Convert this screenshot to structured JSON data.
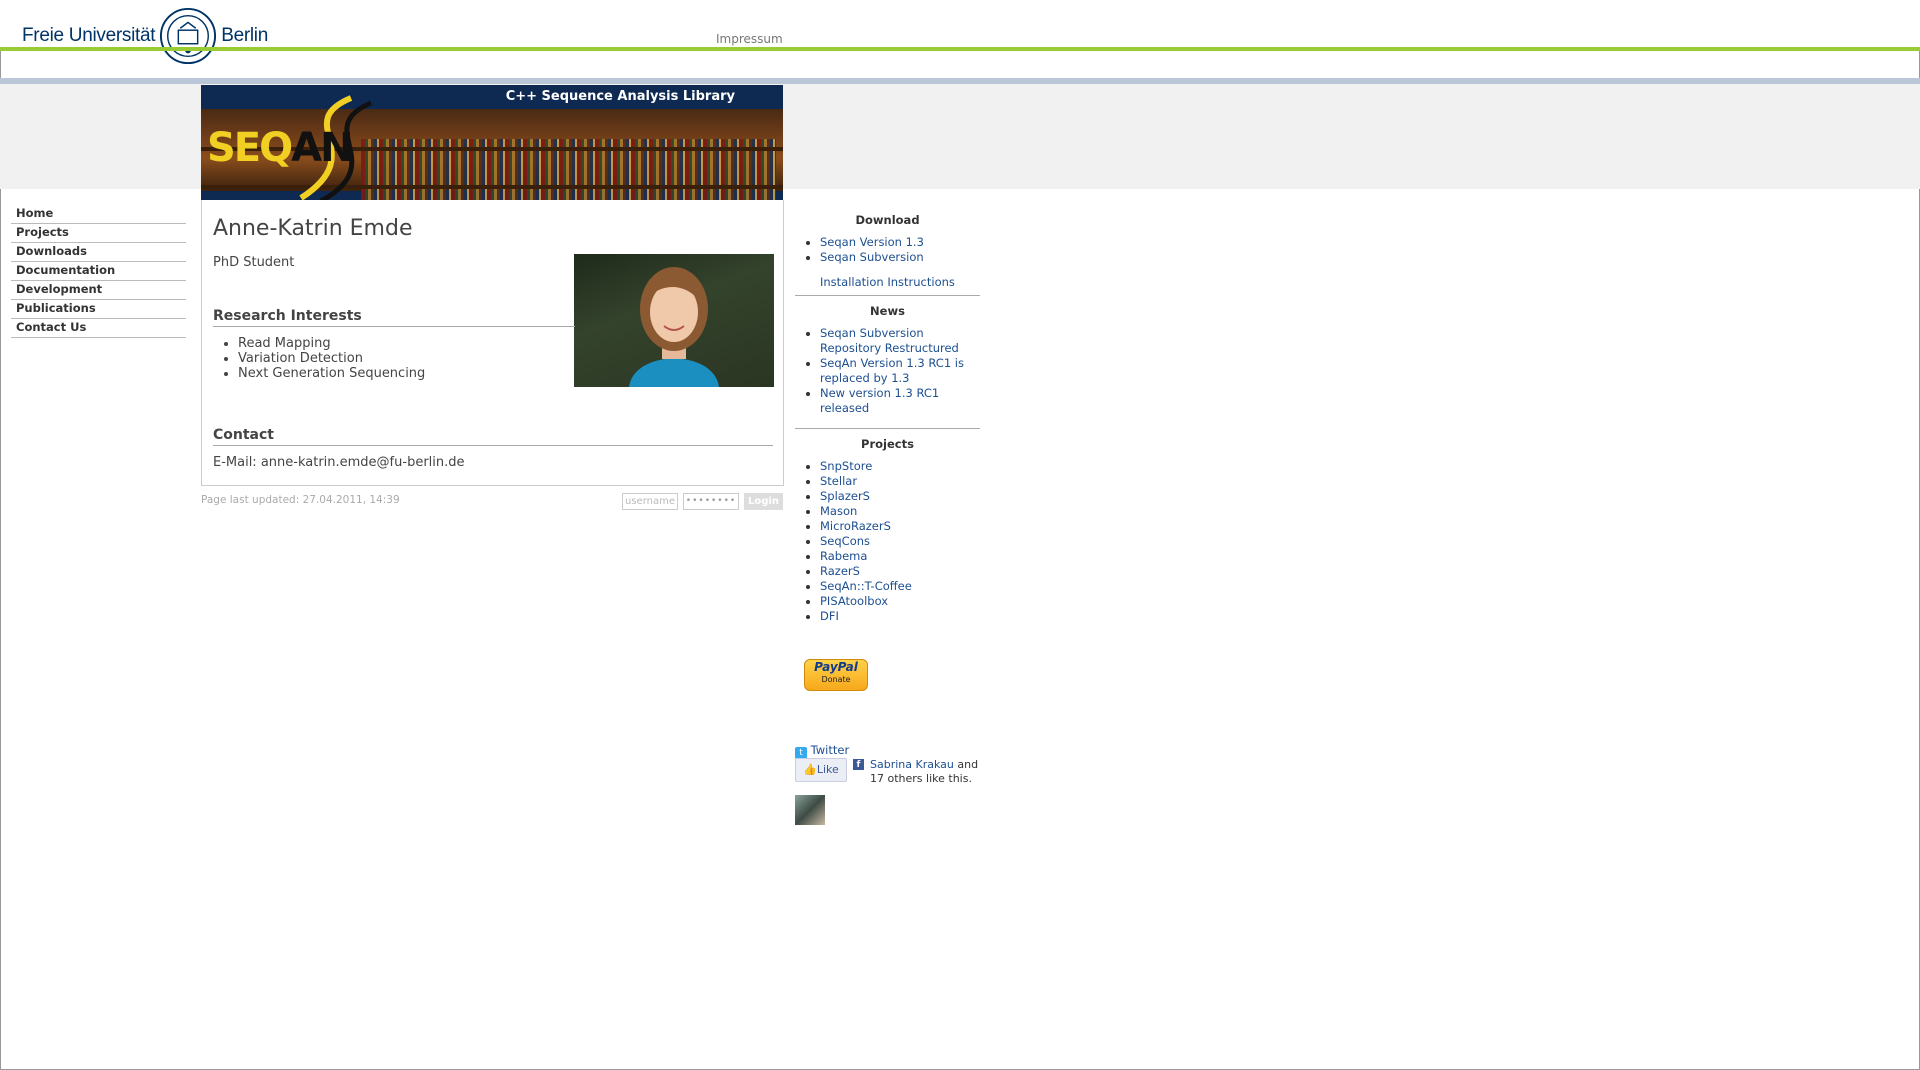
{
  "header": {
    "university_left": "Freie Universität",
    "university_right": "Berlin",
    "impressum": "Impressum"
  },
  "banner": {
    "title": "C++ Sequence Analysis Library",
    "logo_text_a": "SEQ",
    "logo_text_b": "AN"
  },
  "nav": {
    "items": [
      {
        "label": "Home"
      },
      {
        "label": "Projects"
      },
      {
        "label": "Downloads"
      },
      {
        "label": "Documentation"
      },
      {
        "label": "Development"
      },
      {
        "label": "Publications"
      },
      {
        "label": "Contact Us"
      }
    ]
  },
  "profile": {
    "name": "Anne-Katrin Emde",
    "role": "PhD Student",
    "interests_heading": "Research Interests",
    "interests": [
      "Read Mapping",
      "Variation Detection",
      "Next Generation Sequencing"
    ],
    "contact_heading": "Contact",
    "email": "E-Mail: anne-katrin.emde@fu-berlin.de"
  },
  "footer": {
    "updated": "Page last updated: 27.04.2011, 14:39",
    "username_placeholder": "username",
    "password_placeholder": "••••••••",
    "login_label": "Login"
  },
  "sidebar": {
    "download_heading": "Download",
    "download_items": [
      "Seqan Version 1.3",
      "Seqan Subversion"
    ],
    "install_link": "Installation Instructions",
    "news_heading": "News",
    "news_items": [
      "Seqan Subversion Repository Restructured",
      "SeqAn Version 1.3 RC1 is replaced by 1.3",
      "New version 1.3 RC1 released"
    ],
    "projects_heading": "Projects",
    "projects": [
      "SnpStore",
      "Stellar",
      "SplazerS",
      "Mason",
      "MicroRazerS",
      "SeqCons",
      "Rabema",
      "RazerS",
      "SeqAn::T-Coffee",
      "PISAtoolbox",
      "DFI"
    ],
    "paypal_label": "PayPal",
    "donate_label": "Donate",
    "twitter": "Twitter",
    "like_label": "Like",
    "fb_friend": "Sabrina Krakau",
    "fb_rest": " and 17 others like this."
  }
}
